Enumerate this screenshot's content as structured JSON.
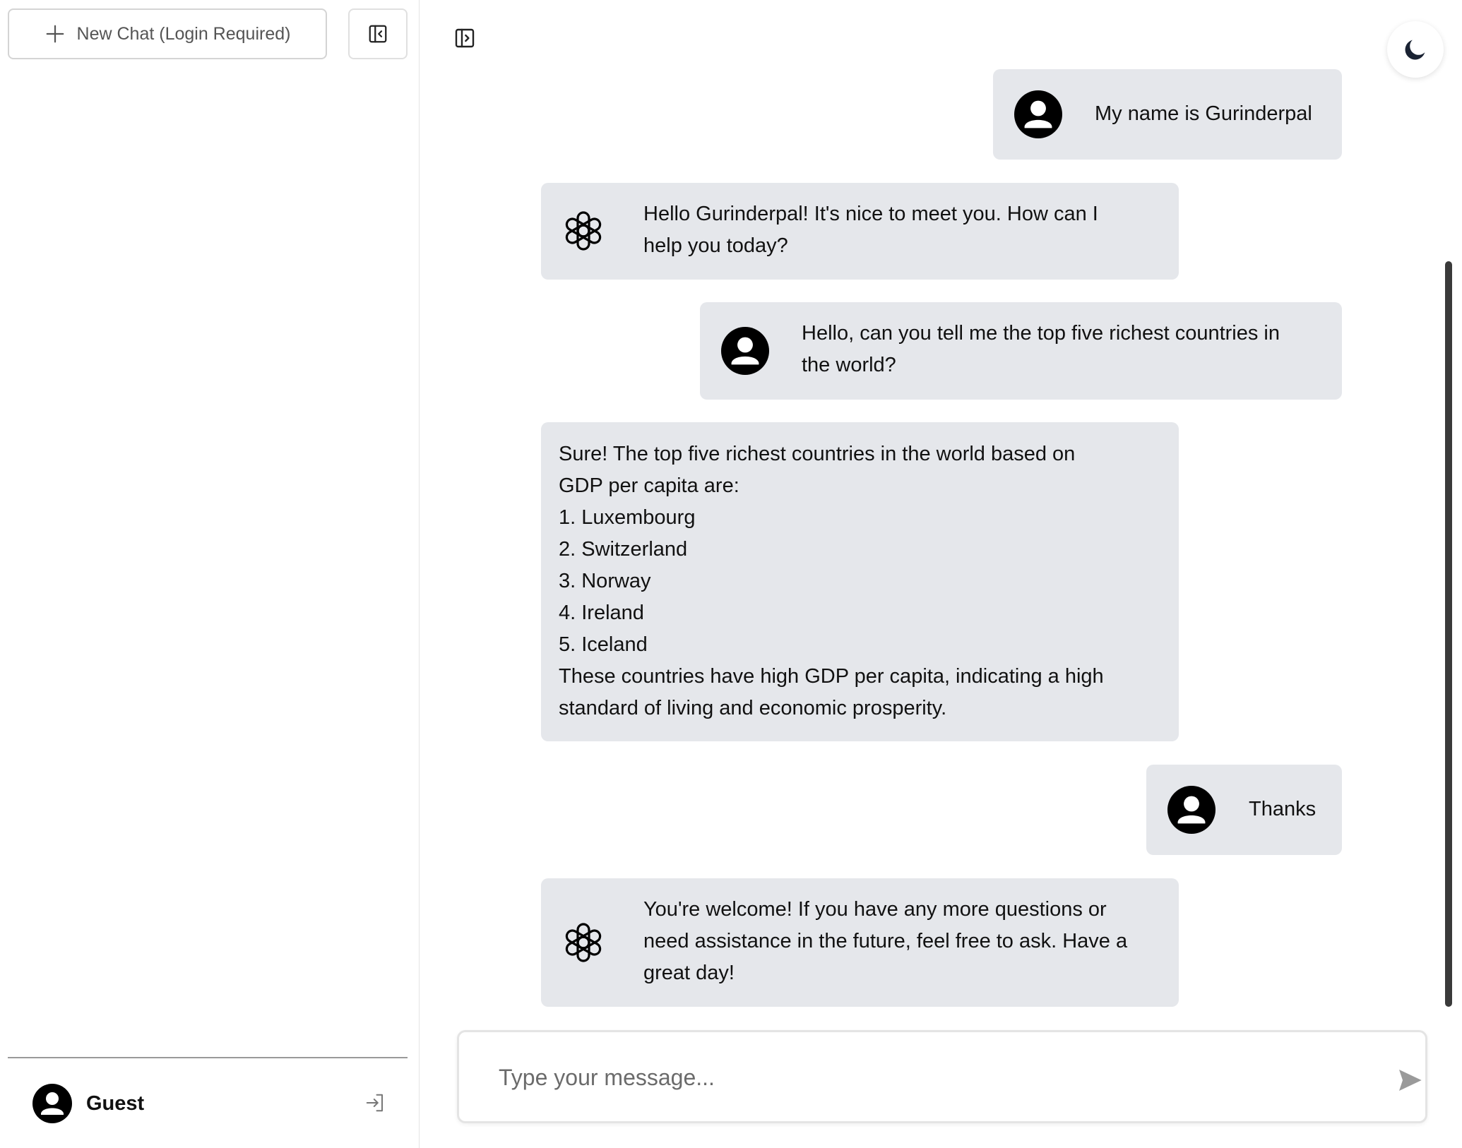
{
  "sidebar": {
    "new_chat_label": "New Chat (Login Required)",
    "user_name": "Guest"
  },
  "composer": {
    "placeholder": "Type your message..."
  },
  "messages": [
    {
      "role": "user",
      "text": "My name is Gurinderpal"
    },
    {
      "role": "assistant",
      "lines": [
        "Hello Gurinderpal! It's nice to meet you. How can I",
        "help you today?"
      ]
    },
    {
      "role": "user",
      "lines": [
        "Hello, can you tell me the top five richest countries in",
        "the world?"
      ]
    },
    {
      "role": "assistant",
      "lines": [
        "Sure! The top five richest countries in the world based on",
        "GDP per capita are:",
        "1. Luxembourg",
        "2. Switzerland",
        "3. Norway",
        "4. Ireland",
        "5. Iceland",
        "These countries have high GDP per capita, indicating a high",
        "standard of living and economic prosperity."
      ]
    },
    {
      "role": "user",
      "text": "Thanks"
    },
    {
      "role": "assistant",
      "lines": [
        "You're welcome! If you have any more questions or",
        "need assistance in the future, feel free to ask. Have a",
        "great day!"
      ]
    }
  ],
  "colors": {
    "bubble_bg": "#e5e7eb",
    "scrollbar": "#3a3a3a",
    "send_icon": "#9a9a9a"
  },
  "icons": {
    "new_chat": "plus-icon",
    "collapse_sidebar": "sidebar-collapse-icon",
    "open_sidebar": "sidebar-expand-icon",
    "theme": "moon-icon",
    "user_avatar": "user-circle-icon",
    "assistant_avatar": "openai-logo-icon",
    "login": "login-icon",
    "send": "send-icon"
  }
}
